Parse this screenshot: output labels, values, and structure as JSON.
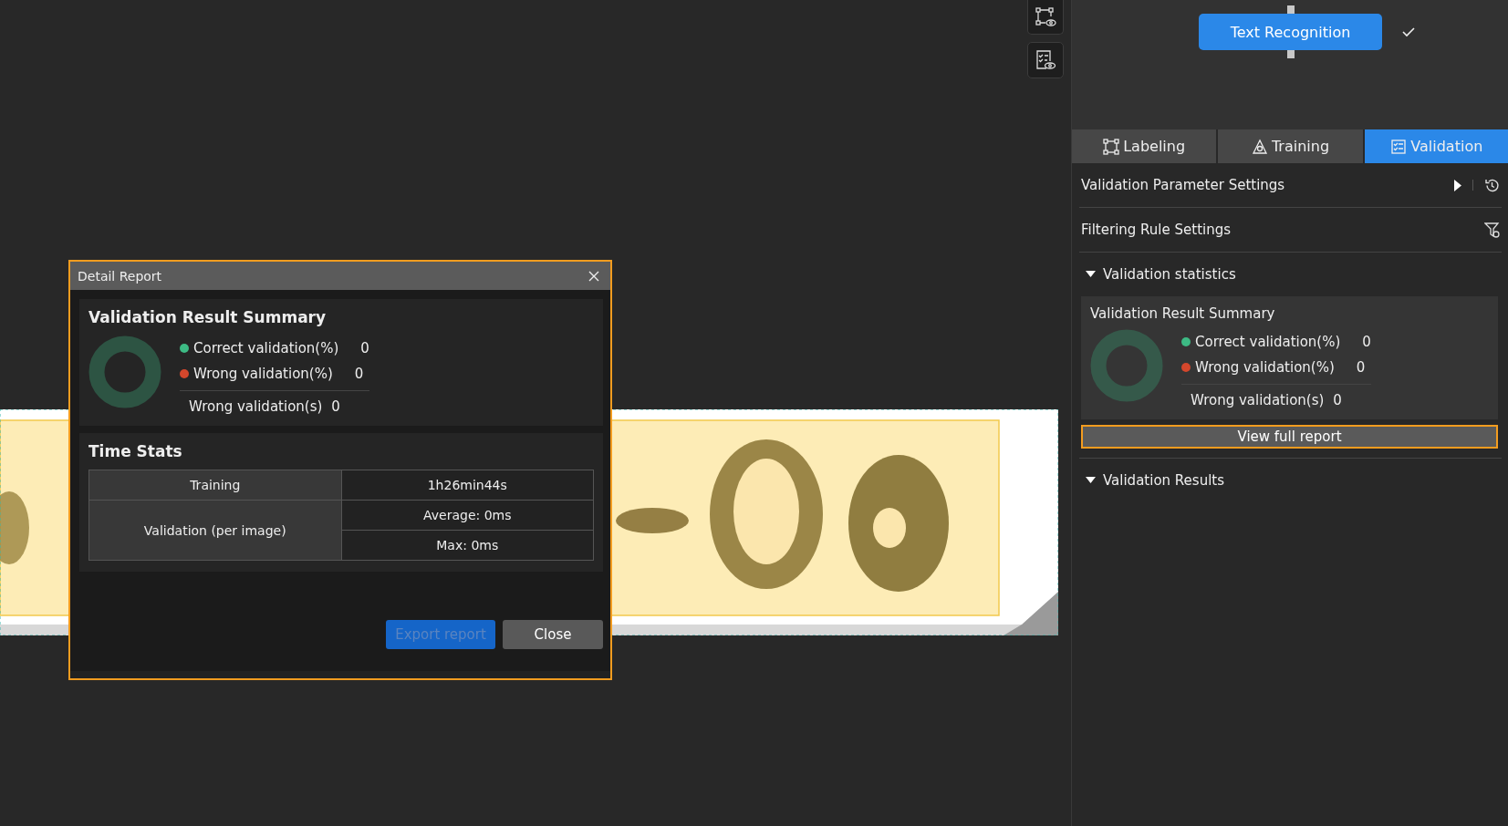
{
  "workflow_node": {
    "label": "Text Recognition",
    "done": true
  },
  "tabs": [
    {
      "label": "Labeling",
      "selected": false
    },
    {
      "label": "Training",
      "selected": false
    },
    {
      "label": "Validation",
      "selected": true
    }
  ],
  "panel": {
    "parameter_settings": "Validation Parameter Settings",
    "filtering_rule_settings": "Filtering Rule Settings",
    "statistics": {
      "title": "Validation statistics",
      "expanded": true,
      "summary": {
        "title": "Validation Result Summary",
        "legend": [
          {
            "label": "Correct validation(%)",
            "value": "0",
            "color": "#3dba84"
          },
          {
            "label": "Wrong validation(%)",
            "value": "0",
            "color": "#d4472c"
          }
        ],
        "count": {
          "label": "Wrong validation(s)",
          "value": "0"
        }
      },
      "view_report_button": "View full report"
    },
    "results": {
      "title": "Validation Results",
      "expanded": true
    }
  },
  "dialog": {
    "title": "Detail Report",
    "summary": {
      "title": "Validation Result Summary",
      "legend": [
        {
          "label": "Correct validation(%)",
          "value": "0",
          "color": "#3dba84"
        },
        {
          "label": "Wrong validation(%)",
          "value": "0",
          "color": "#d4472c"
        }
      ],
      "count": {
        "label": "Wrong validation(s)",
        "value": "0"
      }
    },
    "time_stats": {
      "title": "Time Stats",
      "rows": [
        {
          "label": "Training",
          "values": [
            "1h26min44s"
          ]
        },
        {
          "label": "Validation (per image)",
          "values": [
            "Average: 0ms",
            "Max: 0ms"
          ]
        }
      ]
    },
    "buttons": [
      {
        "label": "Export report",
        "kind": "primary",
        "disabled": true
      },
      {
        "label": "Close",
        "kind": "secondary",
        "disabled": false
      }
    ]
  }
}
